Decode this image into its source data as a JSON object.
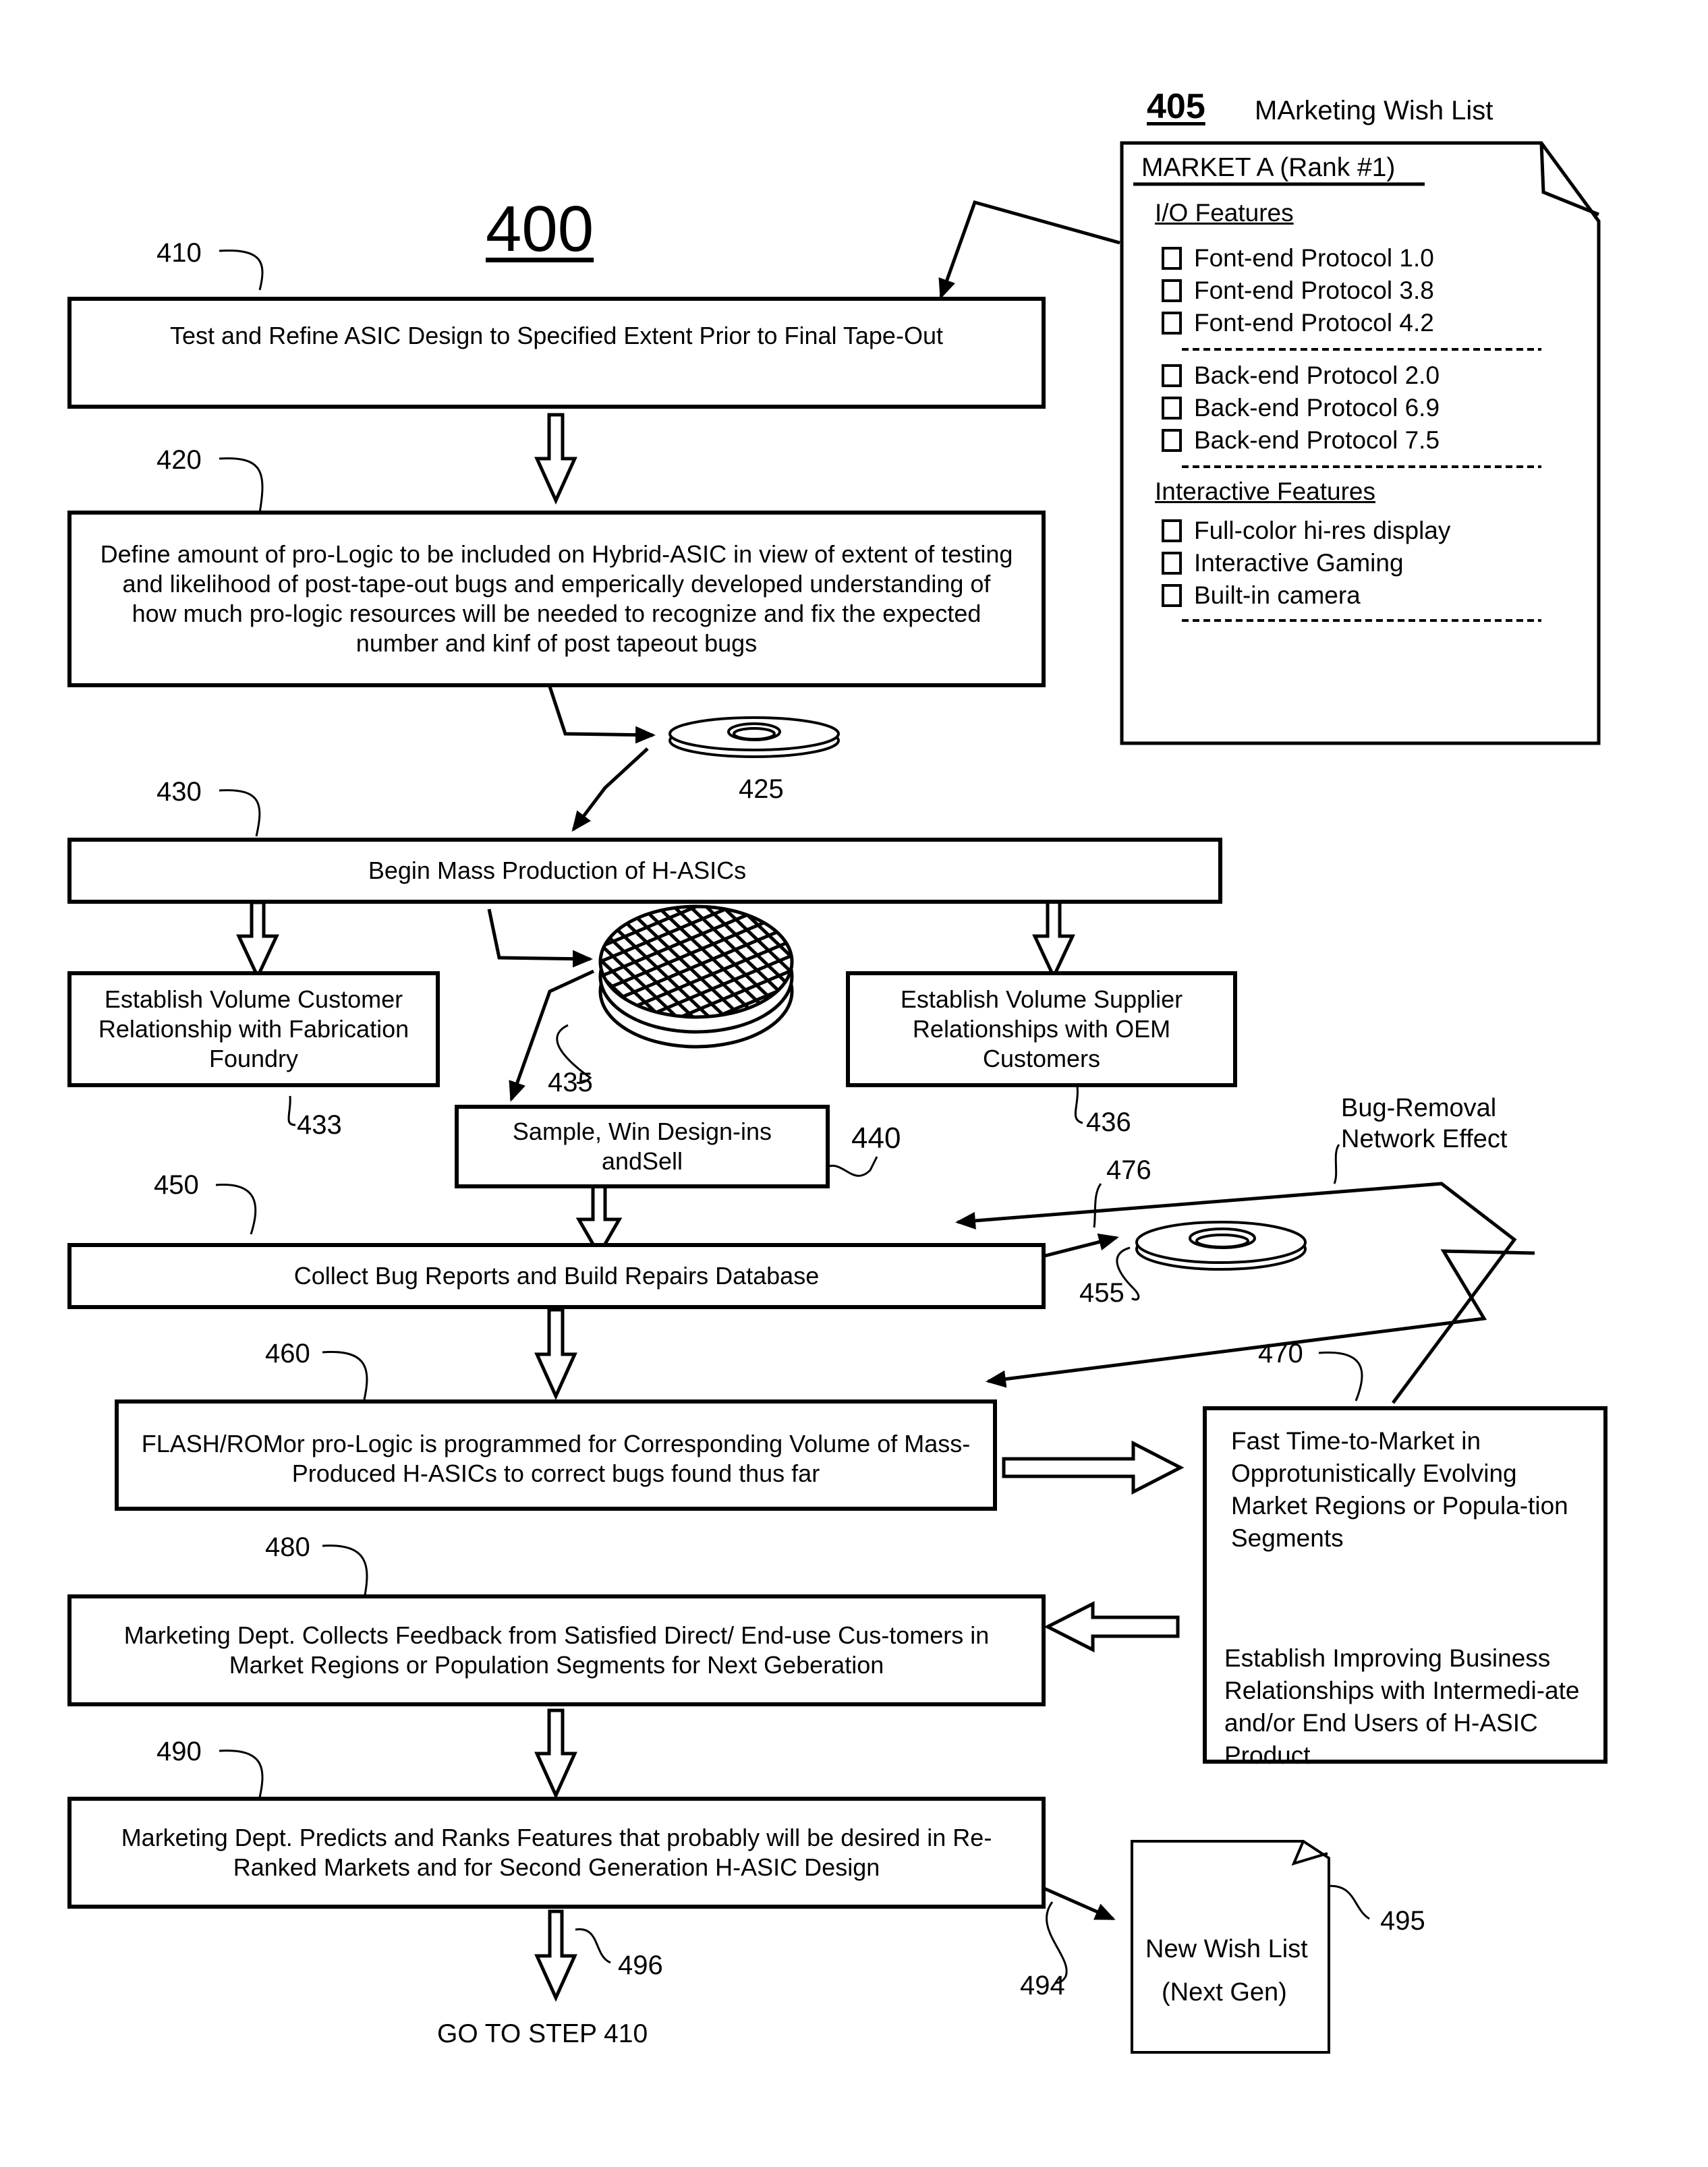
{
  "figure": {
    "number": "400",
    "wish_list_number": "405",
    "wish_list_title": "MArketing Wish List"
  },
  "wish_list": {
    "market": "MARKET A (Rank #1)",
    "io_heading": "I/O Features",
    "frontend": [
      "Font-end Protocol 1.0",
      "Font-end Protocol 3.8",
      "Font-end Protocol 4.2"
    ],
    "backend": [
      "Back-end Protocol 2.0",
      "Back-end Protocol 6.9",
      "Back-end Protocol 7.5"
    ],
    "interactive_heading": "Interactive Features",
    "interactive": [
      "Full-color hi-res display",
      "Interactive Gaming",
      "Built-in camera"
    ]
  },
  "steps": {
    "s410": {
      "ref": "410",
      "text": "Test and Refine ASIC Design to Specified Extent Prior to Final Tape-Out"
    },
    "s420": {
      "ref": "420",
      "text": "Define amount of pro-Logic to be included on Hybrid-ASIC in view of extent of testing and likelihood of post-tape-out bugs and emperically developed understanding of how much pro-logic resources will be needed to recognize and fix the expected number and kinf of post tapeout bugs"
    },
    "s430": {
      "ref": "430",
      "text": "Begin Mass Production of H-ASICs"
    },
    "s433": {
      "ref": "433",
      "text": "Establish Volume Customer Relationship with Fabrication Foundry"
    },
    "s436": {
      "ref": "436",
      "text": "Establish Volume Supplier Relationships with OEM Customers"
    },
    "s440": {
      "ref": "440",
      "text": "Sample, Win Design-ins andSell"
    },
    "s450": {
      "ref": "450",
      "text": "Collect Bug Reports and Build Repairs Database"
    },
    "s460": {
      "ref": "460",
      "text": "FLASH/ROMor pro-Logic is programmed for Corresponding Volume of Mass-Produced H-ASICs to correct bugs found thus far"
    },
    "s470": {
      "ref": "470",
      "text_a": "Fast Time-to-Market in Opprotunistically Evolving Market Regions or Popula-tion Segments",
      "text_b": "Establish Improving Business Relationships with Intermedi-ate and/or End Users of H-ASIC Product"
    },
    "s480": {
      "ref": "480",
      "text": "Marketing Dept. Collects Feedback from Satisfied Direct/ End-use Cus-tomers in Market Regions or Population Segments for Next Geberation"
    },
    "s490": {
      "ref": "490",
      "text": "Marketing Dept. Predicts and Ranks Features that probably will be desired in Re-Ranked Markets and for Second Generation H-ASIC Design"
    }
  },
  "refs": {
    "disk425": "425",
    "wafer435": "435",
    "disk455": "455",
    "r476": "476",
    "network_effect": "Bug-Removal Network Effect",
    "r494": "494",
    "r495": "495",
    "r496": "496"
  },
  "new_wish_list": {
    "line1": "New Wish List",
    "line2": "(Next Gen)"
  },
  "goto": "GO TO STEP 410"
}
